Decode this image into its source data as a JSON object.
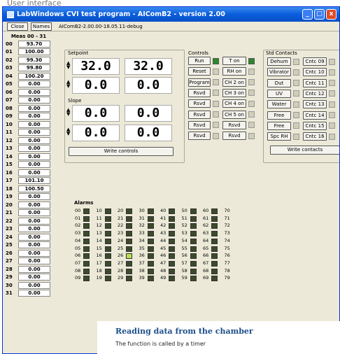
{
  "caption": "User interface",
  "window": {
    "title": "LabWindows CVI test program - AIComB2 - version 2.00",
    "min": "_",
    "max": "□",
    "close": "x"
  },
  "toolbar": {
    "close": "Close",
    "names": "Names",
    "version": "AIComB2-2.00.00-18.05.11-debug"
  },
  "meas": {
    "header": "Meas 00 - 31",
    "rows": [
      [
        "00",
        "93.70"
      ],
      [
        "01",
        "100.00"
      ],
      [
        "02",
        "99.30"
      ],
      [
        "03",
        "99.80"
      ],
      [
        "04",
        "100.20"
      ],
      [
        "05",
        "0.00"
      ],
      [
        "06",
        "0.00"
      ],
      [
        "07",
        "0.00"
      ],
      [
        "08",
        "0.00"
      ],
      [
        "09",
        "0.00"
      ],
      [
        "10",
        "0.00"
      ],
      [
        "11",
        "0.00"
      ],
      [
        "12",
        "0.00"
      ],
      [
        "13",
        "0.00"
      ],
      [
        "14",
        "0.00"
      ],
      [
        "15",
        "0.00"
      ],
      [
        "16",
        "0.00"
      ],
      [
        "17",
        "101.10"
      ],
      [
        "18",
        "100.50"
      ],
      [
        "19",
        "0.00"
      ],
      [
        "20",
        "0.00"
      ],
      [
        "21",
        "0.00"
      ],
      [
        "22",
        "0.00"
      ],
      [
        "23",
        "0.00"
      ],
      [
        "24",
        "0.00"
      ],
      [
        "25",
        "0.00"
      ],
      [
        "26",
        "0.00"
      ],
      [
        "27",
        "0.00"
      ],
      [
        "28",
        "0.00"
      ],
      [
        "29",
        "0.00"
      ],
      [
        "30",
        "0.00"
      ],
      [
        "31",
        "0.00"
      ]
    ]
  },
  "setpoint": {
    "label": "Setpoint",
    "r1": [
      "32.0",
      "32.0"
    ],
    "r2": [
      "0.0",
      "0.0"
    ]
  },
  "slope": {
    "label": "Slope",
    "r1": [
      "0.0",
      "0.0"
    ],
    "r2": [
      "0.0",
      "0.0"
    ]
  },
  "write_controls": "Write controls",
  "controls": {
    "label": "Controls",
    "rows": [
      {
        "a": "Run",
        "b": "T on",
        "aled": true,
        "bled": true
      },
      {
        "a": "Reset",
        "b": "RH on",
        "aled": false,
        "bled": false
      },
      {
        "a": "Program",
        "b": "CH 2 on",
        "aled": false,
        "bled": false
      },
      {
        "a": "Rsvd",
        "b": "CH 3 on",
        "aled": false,
        "bled": false
      },
      {
        "a": "Rsvd",
        "b": "CH 4 on",
        "aled": false,
        "bled": false
      },
      {
        "a": "Rsvd",
        "b": "CH 5 on",
        "aled": false,
        "bled": false
      },
      {
        "a": "Rsvd",
        "b": "Rsvd",
        "aled": false,
        "bled": false
      },
      {
        "a": "Rsvd",
        "b": "Rsvd",
        "aled": false,
        "bled": false
      }
    ]
  },
  "std": {
    "label": "Std Contacts",
    "rows": [
      [
        "Dehum",
        "Cntc 09"
      ],
      [
        "Vibrator",
        "Cntc 10"
      ],
      [
        "Dut",
        "Cntc 11"
      ],
      [
        "UV",
        "Cntc 12"
      ],
      [
        "Water",
        "Cntc 13"
      ],
      [
        "Free",
        "Cntc 14"
      ],
      [
        "Free",
        "Cntc 15"
      ],
      [
        "Spc RH",
        "Cntc 16"
      ]
    ],
    "write": "Write contacts"
  },
  "alarms": {
    "label": "Alarms",
    "on": [
      "26"
    ]
  },
  "overlay": {
    "title": "Reading data from the chamber",
    "sub": "The function is called by a timer"
  }
}
